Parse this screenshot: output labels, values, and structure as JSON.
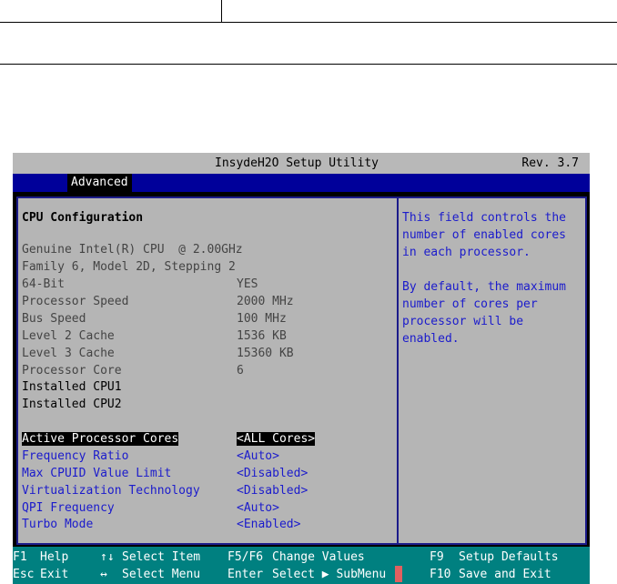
{
  "header": {
    "title": "InsydeH2O Setup Utility",
    "revision": "Rev. 3.7"
  },
  "tabs": [
    {
      "label": "Advanced",
      "selected": true
    }
  ],
  "section": {
    "heading": "CPU Configuration",
    "cpu_name": "Genuine Intel(R) CPU  @ 2.00GHz",
    "cpu_family": "Family 6, Model 2D, Stepping 2"
  },
  "info_rows": [
    {
      "label": "64-Bit",
      "value": "YES"
    },
    {
      "label": "Processor Speed",
      "value": "2000 MHz"
    },
    {
      "label": "Bus Speed",
      "value": "100 MHz"
    },
    {
      "label": "Level 2 Cache",
      "value": "1536 KB"
    },
    {
      "label": "Level 3 Cache",
      "value": "15360 KB"
    },
    {
      "label": "Processor Core",
      "value": "6"
    }
  ],
  "installed": [
    "Installed CPU1",
    "Installed CPU2"
  ],
  "options": [
    {
      "label": "Active Processor Cores",
      "value": "<ALL Cores>",
      "selected": true
    },
    {
      "label": "Frequency Ratio",
      "value": "<Auto>"
    },
    {
      "label": "Max CPUID Value Limit",
      "value": "<Disabled>"
    },
    {
      "label": "Virtualization Technology",
      "value": "<Disabled>"
    },
    {
      "label": "QPI Frequency",
      "value": "<Auto>"
    },
    {
      "label": "Turbo Mode",
      "value": "<Enabled>"
    }
  ],
  "help_text": [
    "This field controls the",
    "number of enabled cores",
    "in each processor.",
    "",
    "By default, the maximum",
    "number of cores per",
    "processor will be",
    "enabled."
  ],
  "footer": {
    "row1": [
      {
        "key": "F1",
        "action": "Help"
      },
      {
        "key": "↑↓",
        "action": "Select Item"
      },
      {
        "key": "F5/F6",
        "action": "Change Values"
      },
      {
        "key": "F9",
        "action": "Setup Defaults"
      }
    ],
    "row2": [
      {
        "key": "Esc",
        "action": "Exit"
      },
      {
        "key": "↔",
        "action": "Select Menu"
      },
      {
        "key": "Enter",
        "action": "Select ▶ SubMenu"
      },
      {
        "key": "F10",
        "action": "Save and Exit"
      }
    ]
  },
  "colors": {
    "title_bar": "#b8b8b8",
    "tab_bar": "#00009a",
    "panel": "#b5b5b5",
    "link": "#1b1bcc",
    "footer": "#008080"
  }
}
